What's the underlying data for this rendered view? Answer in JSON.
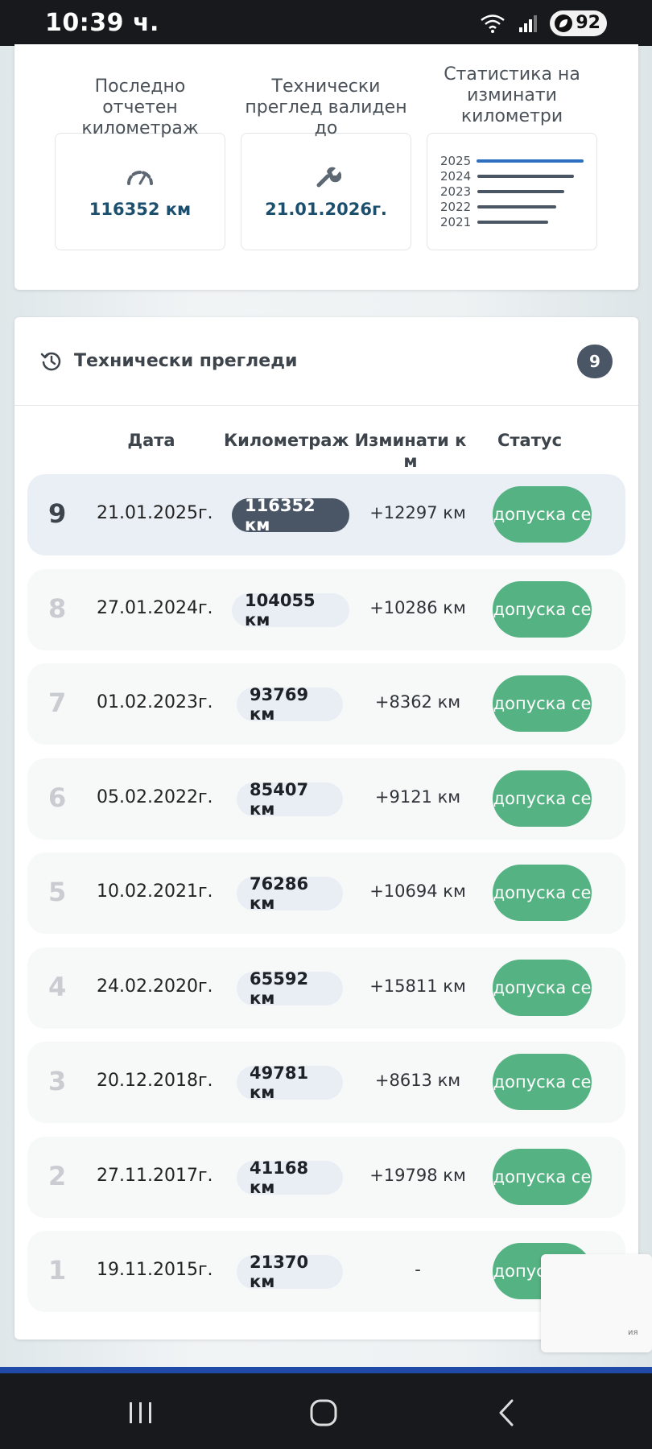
{
  "status_bar": {
    "time": "10:39 ч.",
    "battery": "92"
  },
  "stats": {
    "mileage": {
      "label": "Последно отчетен километраж",
      "value": "116352 км",
      "icon": "speedometer-icon"
    },
    "inspection": {
      "label": "Технически преглед валиден до",
      "value": "21.01.2026г.",
      "icon": "wrench-icon"
    },
    "chart": {
      "label": "Статистика на изминати километри",
      "years": [
        "2025",
        "2024",
        "2023",
        "2022",
        "2021"
      ]
    }
  },
  "inspections": {
    "title": "Технически прегледи",
    "count": "9",
    "columns": [
      "Дата",
      "Километраж",
      "Изминати км",
      "Статус"
    ],
    "rows": [
      {
        "num": "9",
        "date": "21.01.2025г.",
        "km": "116352 км",
        "diff": "+12297 км",
        "status": "допуска се"
      },
      {
        "num": "8",
        "date": "27.01.2024г.",
        "km": "104055 км",
        "diff": "+10286 км",
        "status": "допуска се"
      },
      {
        "num": "7",
        "date": "01.02.2023г.",
        "km": "93769 км",
        "diff": "+8362 км",
        "status": "допуска се"
      },
      {
        "num": "6",
        "date": "05.02.2022г.",
        "km": "85407 км",
        "diff": "+9121 км",
        "status": "допуска се"
      },
      {
        "num": "5",
        "date": "10.02.2021г.",
        "km": "76286 км",
        "diff": "+10694 км",
        "status": "допуска се"
      },
      {
        "num": "4",
        "date": "24.02.2020г.",
        "km": "65592 км",
        "diff": "+15811 км",
        "status": "допуска се"
      },
      {
        "num": "3",
        "date": "20.12.2018г.",
        "km": "49781 км",
        "diff": "+8613 км",
        "status": "допуска се"
      },
      {
        "num": "2",
        "date": "27.11.2017г.",
        "km": "41168 км",
        "diff": "+19798 км",
        "status": "допуска се"
      },
      {
        "num": "1",
        "date": "19.11.2015г.",
        "km": "21370 км",
        "diff": "-",
        "status": "допуска се"
      }
    ]
  },
  "side_widget": {
    "text": "ия"
  },
  "colors": {
    "accent": "#1c4f6e",
    "badge": "#4a5666",
    "status_green": "#55b283",
    "chart_highlight": "#2f6fc0"
  }
}
